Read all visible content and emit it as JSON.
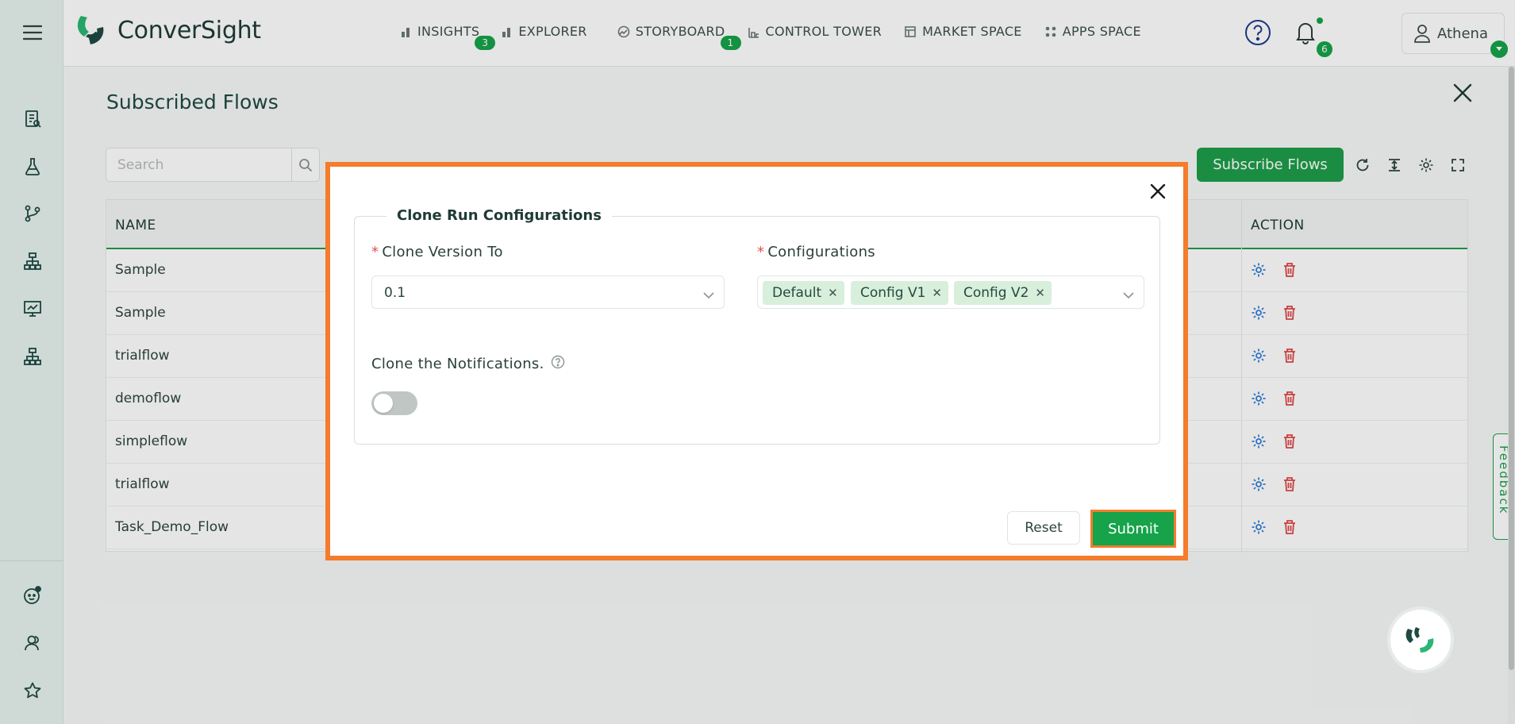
{
  "app": {
    "logo_text": "ConverSight",
    "accent_color": "#16a34a",
    "highlight_color": "#f47c2c"
  },
  "nav": {
    "items": [
      {
        "label": "INSIGHTS",
        "icon": "bar-chart-icon",
        "badge": "3"
      },
      {
        "label": "EXPLORER",
        "icon": "bar-chart-icon",
        "badge": ""
      },
      {
        "label": "STORYBOARD",
        "icon": "storyboard-icon",
        "badge": "1"
      },
      {
        "label": "CONTROL TOWER",
        "icon": "control-tower-icon",
        "badge": ""
      },
      {
        "label": "MARKET SPACE",
        "icon": "market-icon",
        "badge": ""
      },
      {
        "label": "APPS SPACE",
        "icon": "apps-grid-icon",
        "badge": ""
      }
    ]
  },
  "header": {
    "notification_count": "6",
    "user_name": "Athena"
  },
  "page": {
    "title": "Subscribed Flows",
    "search_placeholder": "Search",
    "subscribe_label": "Subscribe Flows",
    "columns": {
      "name": "NAME",
      "action": "ACTION"
    },
    "rows": [
      "Sample",
      "Sample",
      "trialflow",
      "demoflow",
      "simpleflow",
      "trialflow",
      "Task_Demo_Flow"
    ]
  },
  "modal": {
    "legend": "Clone Run Configurations",
    "clone_version_label": "Clone Version To",
    "clone_version_value": "0.1",
    "configurations_label": "Configurations",
    "configurations": [
      "Default",
      "Config V1",
      "Config V2"
    ],
    "notifications_label": "Clone the Notifications.",
    "notifications_enabled": false,
    "reset_label": "Reset",
    "submit_label": "Submit"
  },
  "feedback_label": "Feedback"
}
